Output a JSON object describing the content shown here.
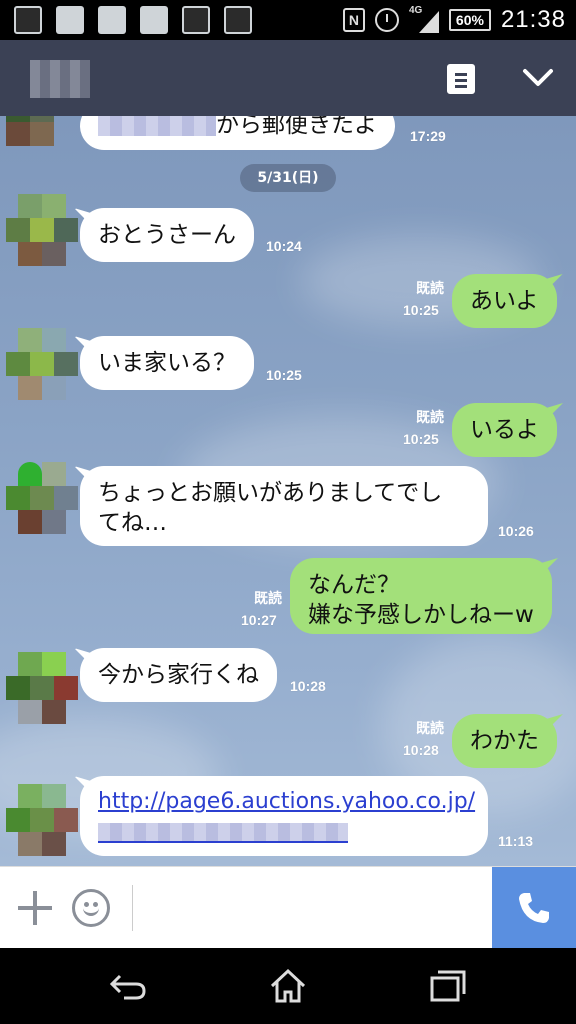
{
  "status_bar": {
    "network": "4G",
    "battery": "60%",
    "time": "21:38",
    "icons": [
      "screenshot-icon",
      "contact-app-icon",
      "sync-icon",
      "wifi-app-icon",
      "briefcase-icon",
      "briefcase-check-icon",
      "nfc-icon",
      "alarm-icon",
      "signal-icon",
      "battery-icon"
    ]
  },
  "header": {
    "icons": [
      "notes-menu-icon",
      "chevron-down-icon"
    ]
  },
  "chat": {
    "date_label": "5/31(日)",
    "read_label": "既読",
    "messages": [
      {
        "side": "theirs",
        "text": "から郵便きたよ",
        "time": "17:29"
      },
      {
        "side": "theirs",
        "text": "おとうさーん",
        "time": "10:24"
      },
      {
        "side": "mine",
        "text": "あいよ",
        "time": "10:25",
        "read": true
      },
      {
        "side": "theirs",
        "text": "いま家いる？",
        "time": "10:25"
      },
      {
        "side": "mine",
        "text": "いるよ",
        "time": "10:25",
        "read": true
      },
      {
        "side": "theirs",
        "line1": "ちょっとお願いがありましてでし",
        "line2": "てね…",
        "time": "10:26"
      },
      {
        "side": "mine",
        "line1": "なんだ？",
        "line2": "嫌な予感しかしねーw",
        "time": "10:27",
        "read": true
      },
      {
        "side": "theirs",
        "text": "今から家行くね",
        "time": "10:28"
      },
      {
        "side": "mine",
        "text": "わかた",
        "time": "10:28",
        "read": true
      },
      {
        "side": "theirs",
        "link": "http://page6.auctions.yahoo.co.jp/",
        "time": "11:13"
      }
    ]
  },
  "input_bar": {
    "icons": [
      "plus-icon",
      "emoji-icon",
      "phone-icon"
    ]
  },
  "nav_bar": {
    "icons": [
      "back-icon",
      "home-icon",
      "recents-icon"
    ]
  },
  "colors": {
    "header_bg": "#3b4155",
    "my_bubble": "#a3e07a",
    "their_bubble": "#ffffff",
    "call_button": "#5a8fe0"
  }
}
